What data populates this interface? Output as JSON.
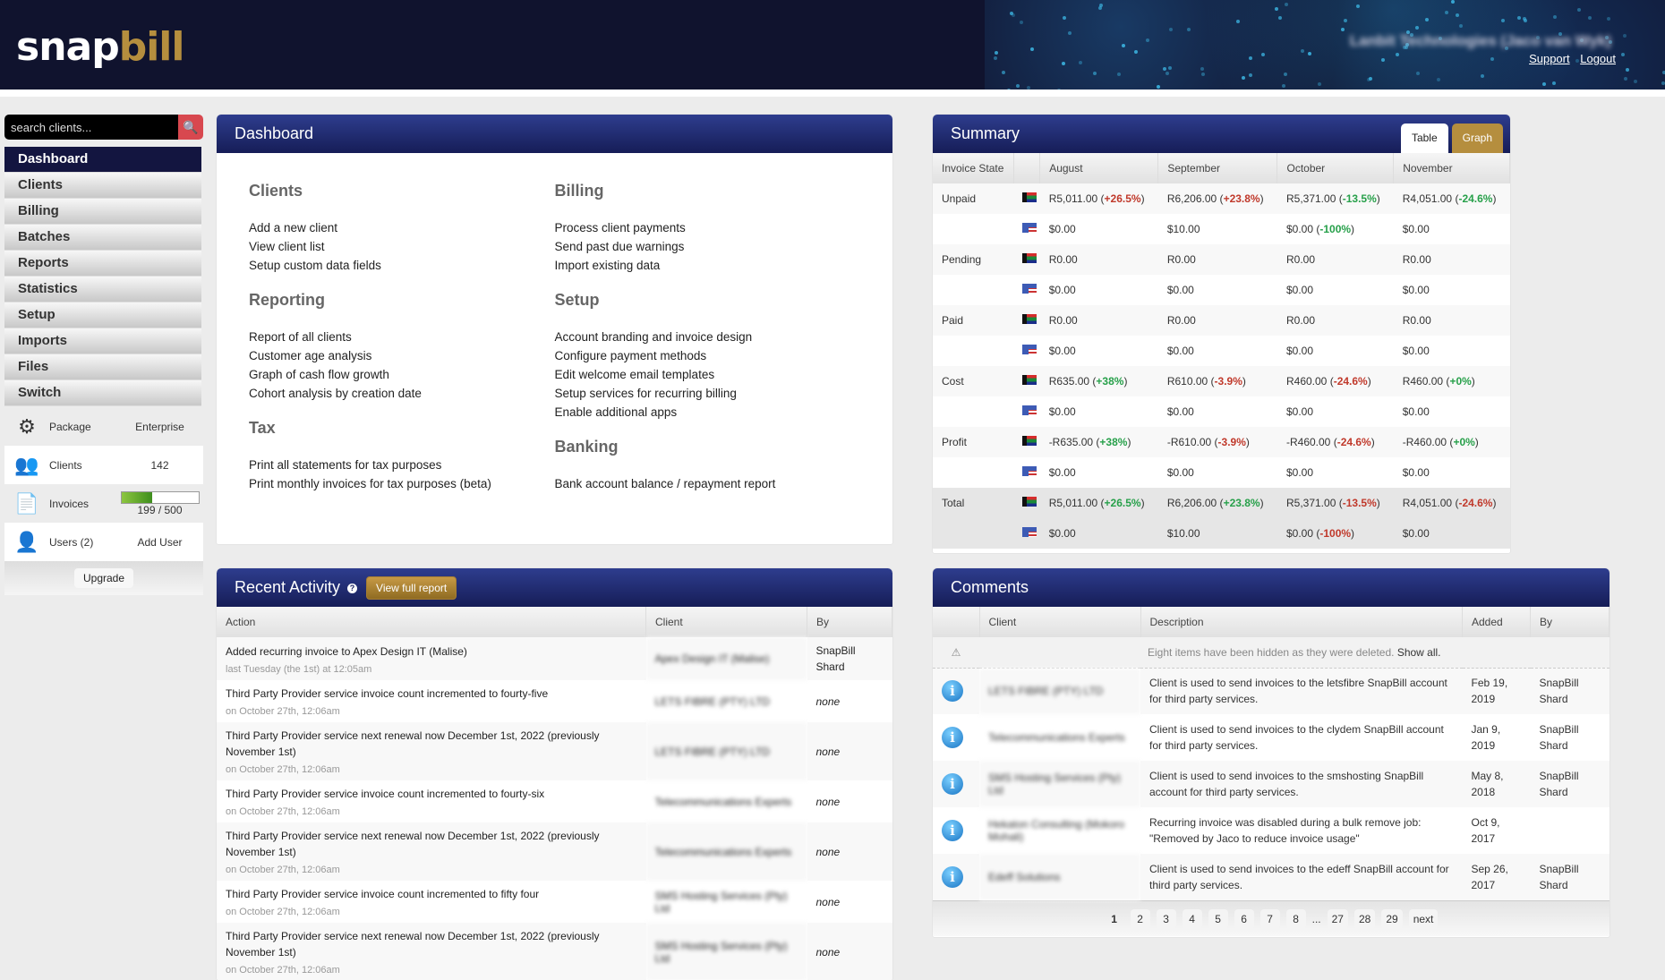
{
  "header": {
    "logo_part1": "snap",
    "logo_part2": "bill",
    "company": "Lanbit Technologies (Jaco van Wyk)",
    "links": [
      "Support",
      "Logout"
    ]
  },
  "search": {
    "placeholder": "search clients..."
  },
  "nav": [
    "Dashboard",
    "Clients",
    "Billing",
    "Batches",
    "Reports",
    "Statistics",
    "Setup",
    "Imports",
    "Files",
    "Switch"
  ],
  "nav_active": "Dashboard",
  "account": {
    "package_label": "Package",
    "package_value": "Enterprise",
    "clients_label": "Clients",
    "clients_value": "142",
    "invoices_label": "Invoices",
    "invoices_text": "199 / 500",
    "invoices_used": 199,
    "invoices_limit": 500,
    "users_label": "Users (2)",
    "add_user": "Add User",
    "upgrade": "Upgrade"
  },
  "dashboard": {
    "title": "Dashboard",
    "left": [
      {
        "heading": "Clients",
        "links": [
          "Add a new client",
          "View client list",
          "Setup custom data fields"
        ]
      },
      {
        "heading": "Reporting",
        "links": [
          "Report of all clients",
          "Customer age analysis",
          "Graph of cash flow growth",
          "Cohort analysis by creation date"
        ]
      },
      {
        "heading": "Tax",
        "links": [
          "Print all statements for tax purposes",
          "Print monthly invoices for tax purposes (beta)"
        ]
      }
    ],
    "right": [
      {
        "heading": "Billing",
        "links": [
          "Process client payments",
          "Send past due warnings",
          "Import existing data"
        ]
      },
      {
        "heading": "Setup",
        "links": [
          "Account branding and invoice design",
          "Configure payment methods",
          "Edit welcome email templates",
          "Setup services for recurring billing",
          "Enable additional apps"
        ]
      },
      {
        "heading": "Banking",
        "links": [
          "Bank account balance / repayment report"
        ]
      }
    ]
  },
  "summary": {
    "title": "Summary",
    "tabs": [
      "Table",
      "Graph"
    ],
    "columns": [
      "Invoice State",
      "",
      "August",
      "September",
      "October",
      "November"
    ],
    "rows": [
      {
        "state": "Unpaid",
        "flag": "za",
        "cells": [
          [
            "R5,011.00",
            "+26.5%",
            "up"
          ],
          [
            "R6,206.00",
            "+23.8%",
            "up"
          ],
          [
            "R5,371.00",
            "-13.5%",
            "down"
          ],
          [
            "R4,051.00",
            "-24.6%",
            "down"
          ]
        ]
      },
      {
        "state": "",
        "flag": "us",
        "cells": [
          [
            "$0.00"
          ],
          [
            "$10.00"
          ],
          [
            "$0.00",
            "-100%",
            "down"
          ],
          [
            "$0.00"
          ]
        ]
      },
      {
        "state": "Pending",
        "flag": "za",
        "cells": [
          [
            "R0.00"
          ],
          [
            "R0.00"
          ],
          [
            "R0.00"
          ],
          [
            "R0.00"
          ]
        ]
      },
      {
        "state": "",
        "flag": "us",
        "cells": [
          [
            "$0.00"
          ],
          [
            "$0.00"
          ],
          [
            "$0.00"
          ],
          [
            "$0.00"
          ]
        ]
      },
      {
        "state": "Paid",
        "flag": "za",
        "cells": [
          [
            "R0.00"
          ],
          [
            "R0.00"
          ],
          [
            "R0.00"
          ],
          [
            "R0.00"
          ]
        ]
      },
      {
        "state": "",
        "flag": "us",
        "cells": [
          [
            "$0.00"
          ],
          [
            "$0.00"
          ],
          [
            "$0.00"
          ],
          [
            "$0.00"
          ]
        ]
      },
      {
        "state": "Cost",
        "flag": "za",
        "cells": [
          [
            "R635.00",
            "+38%",
            "upg"
          ],
          [
            "R610.00",
            "-3.9%",
            "downr"
          ],
          [
            "R460.00",
            "-24.6%",
            "downr"
          ],
          [
            "R460.00",
            "+0%",
            "upg"
          ]
        ]
      },
      {
        "state": "",
        "flag": "us",
        "cells": [
          [
            "$0.00"
          ],
          [
            "$0.00"
          ],
          [
            "$0.00"
          ],
          [
            "$0.00"
          ]
        ]
      },
      {
        "state": "Profit",
        "flag": "za",
        "cells": [
          [
            "-R635.00",
            "+38%",
            "upg"
          ],
          [
            "-R610.00",
            "-3.9%",
            "downr"
          ],
          [
            "-R460.00",
            "-24.6%",
            "downr"
          ],
          [
            "-R460.00",
            "+0%",
            "upg"
          ]
        ]
      },
      {
        "state": "",
        "flag": "us",
        "cells": [
          [
            "$0.00"
          ],
          [
            "$0.00"
          ],
          [
            "$0.00"
          ],
          [
            "$0.00"
          ]
        ]
      },
      {
        "state": "Total",
        "flag": "za",
        "total": true,
        "cells": [
          [
            "R5,011.00",
            "+26.5%",
            "upg"
          ],
          [
            "R6,206.00",
            "+23.8%",
            "upg"
          ],
          [
            "R5,371.00",
            "-13.5%",
            "downr"
          ],
          [
            "R4,051.00",
            "-24.6%",
            "downr"
          ]
        ]
      },
      {
        "state": "",
        "flag": "us",
        "total": true,
        "cells": [
          [
            "$0.00"
          ],
          [
            "$10.00"
          ],
          [
            "$0.00",
            "-100%",
            "downr"
          ],
          [
            "$0.00"
          ]
        ]
      }
    ]
  },
  "activity": {
    "title": "Recent Activity",
    "button": "View full report",
    "columns": [
      "Action",
      "Client",
      "By"
    ],
    "rows": [
      {
        "action": "Added recurring invoice to Apex Design IT (Malise)",
        "time": "last Tuesday (the 1st) at 12:05am",
        "client": "Apex Design IT (Malise)",
        "by": "SnapBill Shard"
      },
      {
        "action": "Third Party Provider service invoice count incremented to fourty-five",
        "time": "on October 27th, 12:06am",
        "client": "LETS FIBRE (PTY) LTD",
        "by": "none"
      },
      {
        "action": "Third Party Provider service next renewal now December 1st, 2022 (previously November 1st)",
        "time": "on October 27th, 12:06am",
        "client": "LETS FIBRE (PTY) LTD",
        "by": "none"
      },
      {
        "action": "Third Party Provider service invoice count incremented to fourty-six",
        "time": "on October 27th, 12:06am",
        "client": "Telecommunications Experts",
        "by": "none"
      },
      {
        "action": "Third Party Provider service next renewal now December 1st, 2022 (previously November 1st)",
        "time": "on October 27th, 12:06am",
        "client": "Telecommunications Experts",
        "by": "none"
      },
      {
        "action": "Third Party Provider service invoice count incremented to fifty four",
        "time": "on October 27th, 12:06am",
        "client": "SMS Hosting Services (Pty) Ltd",
        "by": "none"
      },
      {
        "action": "Third Party Provider service next renewal now December 1st, 2022 (previously November 1st)",
        "time": "on October 27th, 12:06am",
        "client": "SMS Hosting Services (Pty) Ltd",
        "by": "none"
      }
    ]
  },
  "comments": {
    "title": "Comments",
    "columns": [
      "",
      "Client",
      "Description",
      "Added",
      "By"
    ],
    "hidden_notice": "Eight items have been hidden as they were deleted.",
    "show_all": "Show all.",
    "rows": [
      {
        "client": "LETS FIBRE (PTY) LTD",
        "desc": "Client is used to send invoices to the letsfibre SnapBill account for third party services.",
        "added": "Feb 19, 2019",
        "by": "SnapBill Shard"
      },
      {
        "client": "Telecommunications Experts",
        "desc": "Client is used to send invoices to the clydem SnapBill account for third party services.",
        "added": "Jan 9, 2019",
        "by": "SnapBill Shard"
      },
      {
        "client": "SMS Hosting Services (Pty) Ltd",
        "desc": "Client is used to send invoices to the smshosting SnapBill account for third party services.",
        "added": "May 8, 2018",
        "by": "SnapBill Shard"
      },
      {
        "client": "Hekaton Consulting (Mokoro Mohali)",
        "desc": "Recurring invoice was disabled during a bulk remove job: \"Removed by Jaco to reduce invoice usage\"",
        "added": "Oct 9, 2017",
        "by": ""
      },
      {
        "client": "Edeff Solutions",
        "desc": "Client is used to send invoices to the edeff SnapBill account for third party services.",
        "added": "Sep 26, 2017",
        "by": "SnapBill Shard"
      }
    ],
    "pages": [
      "1",
      "2",
      "3",
      "4",
      "5",
      "6",
      "7",
      "8",
      "...",
      "27",
      "28",
      "29",
      "next"
    ],
    "current_page": "1"
  }
}
